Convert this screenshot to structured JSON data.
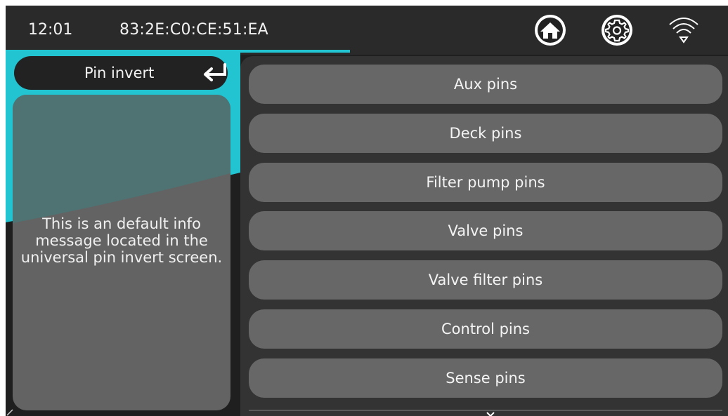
{
  "status_bar": {
    "time": "12:01",
    "mac_address": "83:2E:C0:CE:51:EA",
    "icons": [
      "home-icon",
      "gear-icon",
      "wifi-icon"
    ]
  },
  "sidebar": {
    "back_label": "Pin invert",
    "back_icon": "return-arrow-icon",
    "info_message": "This is an default info message located in the universal pin invert screen."
  },
  "menu": {
    "items": [
      {
        "label": "Aux pins"
      },
      {
        "label": "Deck pins"
      },
      {
        "label": "Filter pump pins"
      },
      {
        "label": "Valve pins"
      },
      {
        "label": "Valve filter pins"
      },
      {
        "label": "Control pins"
      },
      {
        "label": "Sense pins"
      }
    ],
    "more_icon": "chevron-down-icon"
  },
  "colors": {
    "accent": "#21c4d0",
    "background": "#1f1f1f",
    "button": "#676767",
    "panel": "#333333"
  }
}
